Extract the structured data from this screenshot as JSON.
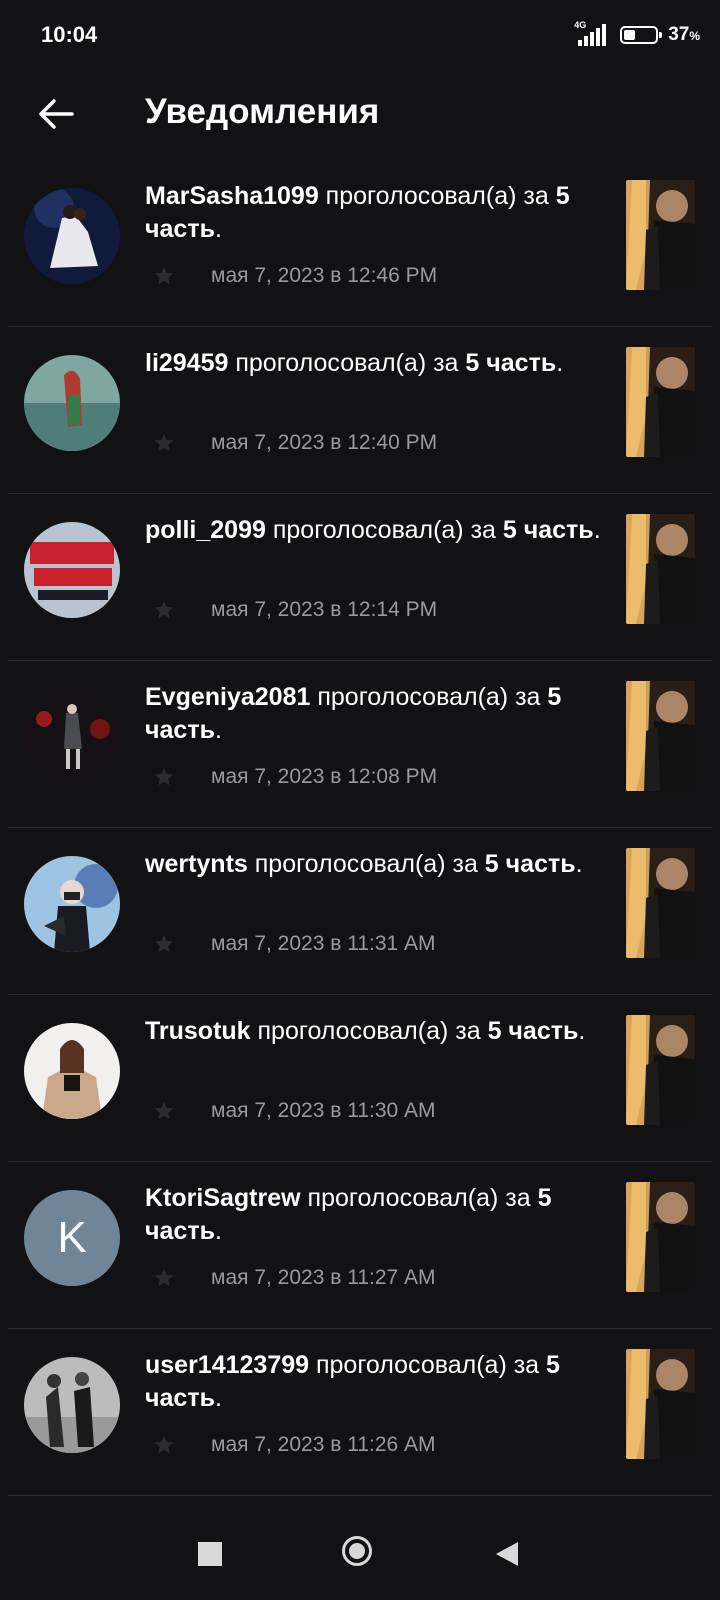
{
  "status_bar": {
    "time": "10:04",
    "network": "4G",
    "battery_percent": "37",
    "battery_unit": "%",
    "battery_level": 0.37
  },
  "header": {
    "back_icon": "arrow-left-icon",
    "title": "Уведомления"
  },
  "notifications": [
    {
      "username": "MarSasha1099",
      "action": " проголосовал(а) за ",
      "part": "5 часть",
      "suffix": ".",
      "date": "мая 7, 2023 в 12:46 PM",
      "avatar_type": "photo"
    },
    {
      "username": "li29459",
      "action": " проголосовал(а) за ",
      "part": "5 часть",
      "suffix": ".",
      "date": "мая 7, 2023 в 12:40 PM",
      "avatar_type": "photo"
    },
    {
      "username": "polli_2099",
      "action": " проголосовал(а) за ",
      "part": "5 часть",
      "suffix": ".",
      "date": "мая 7, 2023 в 12:14 PM",
      "avatar_type": "photo"
    },
    {
      "username": "Evgeniya2081",
      "action": " проголосовал(а) за ",
      "part": "5 часть",
      "suffix": ".",
      "date": "мая 7, 2023 в 12:08 PM",
      "avatar_type": "photo"
    },
    {
      "username": "wertynts",
      "action": " проголосовал(а) за ",
      "part": "5 часть",
      "suffix": ".",
      "date": "мая 7, 2023 в 11:31 AM",
      "avatar_type": "photo"
    },
    {
      "username": "Trusotuk",
      "action": " проголосовал(а) за ",
      "part": "5 часть",
      "suffix": ".",
      "date": "мая 7, 2023 в 11:30 AM",
      "avatar_type": "photo"
    },
    {
      "username": "KtoriSagtrew",
      "action": " проголосовал(а) за ",
      "part": "5 часть",
      "suffix": ".",
      "date": "мая 7, 2023 в 11:27 AM",
      "avatar_type": "letter",
      "avatar_letter": "K"
    },
    {
      "username": "user14123799",
      "action": " проголосовал(а) за ",
      "part": "5 часть",
      "suffix": ".",
      "date": "мая 7, 2023 в 11:26 AM",
      "avatar_type": "photo"
    }
  ],
  "icons": {
    "vote": "star-icon",
    "thumbnail": "story-cover-image"
  },
  "colors": {
    "background": "#121113",
    "text_primary": "#ffffff",
    "text_secondary": "#9a999c",
    "divider": "#2c2b2e",
    "letter_avatar": "#6f8698"
  },
  "nav_bar": {
    "recents_icon": "square-recents-icon",
    "home_icon": "circle-home-icon",
    "back_icon": "triangle-back-icon"
  }
}
